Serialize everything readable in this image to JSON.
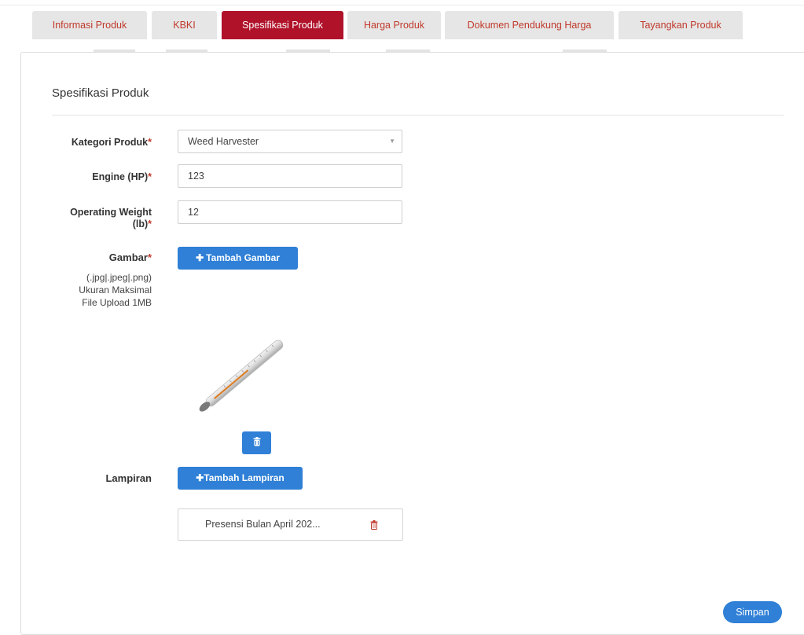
{
  "tabs": [
    {
      "label": "Informasi Produk"
    },
    {
      "label": "KBKI"
    },
    {
      "label": "Spesifikasi Produk",
      "active": true
    },
    {
      "label": "Harga Produk"
    },
    {
      "label": "Dokumen Pendukung Harga"
    },
    {
      "label": "Tayangkan Produk"
    }
  ],
  "section_title": "Spesifikasi Produk",
  "form": {
    "kategori_label": "Kategori Produk",
    "kategori_value": "Weed Harvester",
    "engine_label": "Engine (HP)",
    "engine_value": "123",
    "weight_label_1": "Operating Weight",
    "weight_label_2": "(lb)",
    "weight_value": "12",
    "gambar_label": "Gambar",
    "gambar_hint_1": "(.jpg|.jpeg|.png)",
    "gambar_hint_2": "Ukuran Maksimal",
    "gambar_hint_3": "File Upload 1MB",
    "tambah_gambar": "Tambah Gambar",
    "lampiran_label": "Lampiran",
    "tambah_lampiran": "Tambah Lampiran",
    "attachment_name": "Presensi Bulan April 202...",
    "required_mark": "*"
  },
  "save_label": "Simpan",
  "colors": {
    "accent": "#b0122a",
    "primary": "#2f80d6",
    "tab_bg": "#e6e6e6"
  }
}
